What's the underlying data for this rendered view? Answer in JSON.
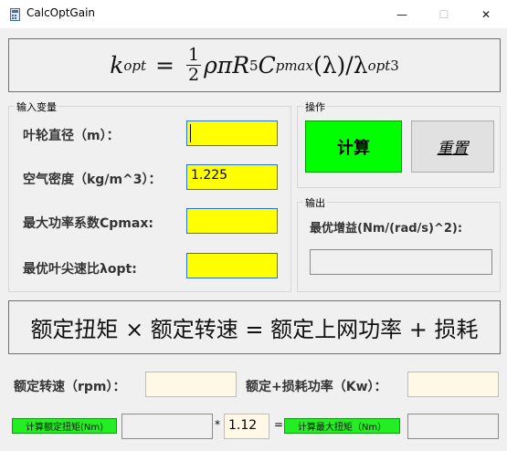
{
  "window": {
    "title": "CalcOptGain",
    "minimize": "—",
    "maximize": "☐",
    "close": "✕"
  },
  "formula_top": {
    "k": "k",
    "k_sub": "opt",
    "eq": "=",
    "frac_num": "1",
    "frac_den": "2",
    "mid": "ρπR",
    "r_exp": "5",
    "c": "C",
    "c_sub": "pmax",
    "tail": "(λ)/λ",
    "lam_sub": "opt",
    "lam_exp": "3"
  },
  "inputs": {
    "group_label": "输入变量",
    "diameter_label": "叶轮直径（m）：",
    "diameter_value": "",
    "density_label": "空气密度（kg/m^3）：",
    "density_value": "1.225",
    "cpmax_label": "最大功率系数Cpmax:",
    "cpmax_value": "",
    "tsr_label": "最优叶尖速比λopt:",
    "tsr_value": ""
  },
  "actions": {
    "group_label": "操作",
    "calc_label": "计算",
    "reset_label": "重置",
    "calc_color": "#00ff00"
  },
  "output": {
    "group_label": "输出",
    "gain_label": "最优增益(Nm/(rad/s)^2):",
    "gain_value": ""
  },
  "formula_bottom": {
    "text": "额定扭矩 × 额定转速 = 额定上网功率 + 损耗"
  },
  "rated": {
    "speed_label": "额定转速（rpm）：",
    "speed_value": "",
    "power_label": "额定+损耗功率（Kw）：",
    "power_value": "",
    "torque_button": "计算额定扭矩(Nm)",
    "torque_value": "",
    "times": "*",
    "factor_value": "1.12",
    "equals": "=",
    "max_torque_button": "计算最大扭矩（Nm）",
    "max_torque_value": ""
  }
}
